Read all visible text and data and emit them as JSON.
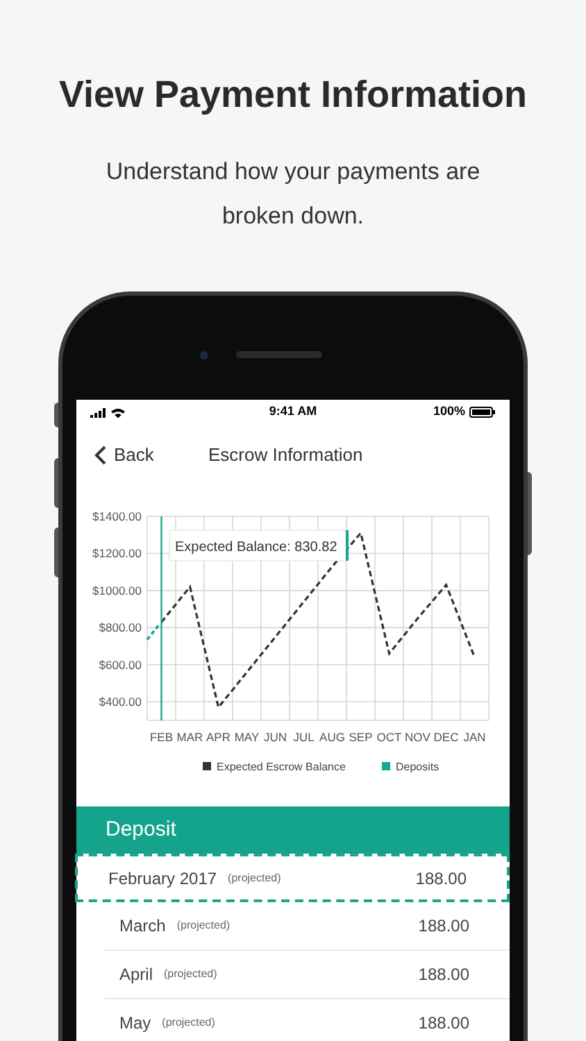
{
  "headline": "View Payment Information",
  "subtitle": "Understand how your payments are broken down.",
  "status_bar": {
    "time": "9:41 AM",
    "battery": "100%"
  },
  "nav": {
    "back": "Back",
    "title": "Escrow Information"
  },
  "chart": {
    "tooltip": "Expected Balance: 830.82",
    "chart_data": {
      "type": "line",
      "grid": true,
      "categories": [
        "FEB",
        "MAR",
        "APR",
        "MAY",
        "JUN",
        "JUL",
        "AUG",
        "SEP",
        "OCT",
        "NOV",
        "DEC",
        "JAN"
      ],
      "series": [
        {
          "name": "Expected Escrow Balance",
          "color": "#333333",
          "line_style": "dashed",
          "values": [
            830,
            1020,
            370,
            560,
            750,
            940,
            1130,
            1310,
            660,
            850,
            1030,
            640
          ]
        },
        {
          "name": "Deposits",
          "color": "#17a78d",
          "values": [
            null,
            null,
            null,
            null,
            null,
            null,
            null,
            null,
            null,
            null,
            null,
            null
          ]
        }
      ],
      "ref_lines": [
        {
          "axis": "x",
          "value": "FEB",
          "color": "#17a78d"
        }
      ],
      "ylim": [
        300,
        1400
      ],
      "yticks": [
        {
          "value": 400,
          "label": "$400.00"
        },
        {
          "value": 600,
          "label": "$600.00"
        },
        {
          "value": 800,
          "label": "$800.00"
        },
        {
          "value": 1000,
          "label": "$1000.00"
        },
        {
          "value": 1200,
          "label": "$1200.00"
        },
        {
          "value": 1400,
          "label": "$1400.00"
        }
      ]
    }
  },
  "deposit": {
    "title": "Deposit",
    "rows": [
      {
        "label": "February 2017",
        "note": "(projected)",
        "amount": "188.00",
        "selected": true
      },
      {
        "label": "March",
        "note": "(projected)",
        "amount": "188.00",
        "selected": false
      },
      {
        "label": "April",
        "note": "(projected)",
        "amount": "188.00",
        "selected": false
      },
      {
        "label": "May",
        "note": "(projected)",
        "amount": "188.00",
        "selected": false
      }
    ]
  }
}
